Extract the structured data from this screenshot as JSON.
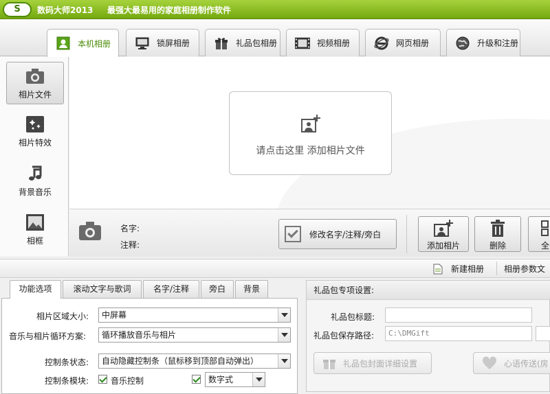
{
  "titlebar": {
    "logo": "S",
    "title": "数码大师2013",
    "slogan": "最强大最易用的家庭相册制作软件"
  },
  "tabs": [
    {
      "label": "本机相册",
      "icon": "photo-person-icon",
      "active": true
    },
    {
      "label": "锁屏相册",
      "icon": "monitor-icon"
    },
    {
      "label": "礼品包相册",
      "icon": "gift-icon"
    },
    {
      "label": "视频相册",
      "icon": "film-icon"
    },
    {
      "label": "网页相册",
      "icon": "ie-browser-icon"
    },
    {
      "label": "升级和注册",
      "icon": "globe-icon"
    }
  ],
  "left_nav": [
    {
      "label": "相片文件",
      "icon": "camera-icon",
      "active": true
    },
    {
      "label": "相片特效",
      "icon": "sparkle-effects-icon"
    },
    {
      "label": "背景音乐",
      "icon": "music-note-icon"
    },
    {
      "label": "相框",
      "icon": "picture-frame-icon"
    }
  ],
  "canvas": {
    "add_prompt": "请点击这里  添加相片文件"
  },
  "info": {
    "name_label": "名字:",
    "note_label": "注释:",
    "edit_button": "修改名字/注释/旁白",
    "add_button": "添加相片",
    "delete_button": "删除",
    "all_button": "全"
  },
  "subbar": {
    "new_album": "新建相册",
    "album_params": "相册参数文"
  },
  "lower_tabs": [
    "功能选项",
    "滚动文字与歌词",
    "名字/注释",
    "旁白",
    "背景"
  ],
  "options": {
    "area_label": "相片区域大小:",
    "area_value": "中屏幕",
    "loop_label": "音乐与相片循环方案:",
    "loop_value": "循环播放音乐与相片",
    "ctrl_state_label": "控制条状态:",
    "ctrl_state_value": "自动隐藏控制条（鼠标移到顶部自动弹出）",
    "ctrl_module_label": "控制条模块:",
    "music_control": "音乐控制",
    "digital_value": "数字式"
  },
  "gift": {
    "header": "礼品包专项设置:",
    "title_label": "礼品包标题:",
    "path_label": "礼品包保存路径:",
    "path_value": "C:\\DMGift",
    "cover_button": "礼品包封面详细设置",
    "heart_button": "心语传送(房"
  },
  "colors": {
    "accent_green": "#74a80f",
    "active_tab_text": "#4c8c0a"
  }
}
